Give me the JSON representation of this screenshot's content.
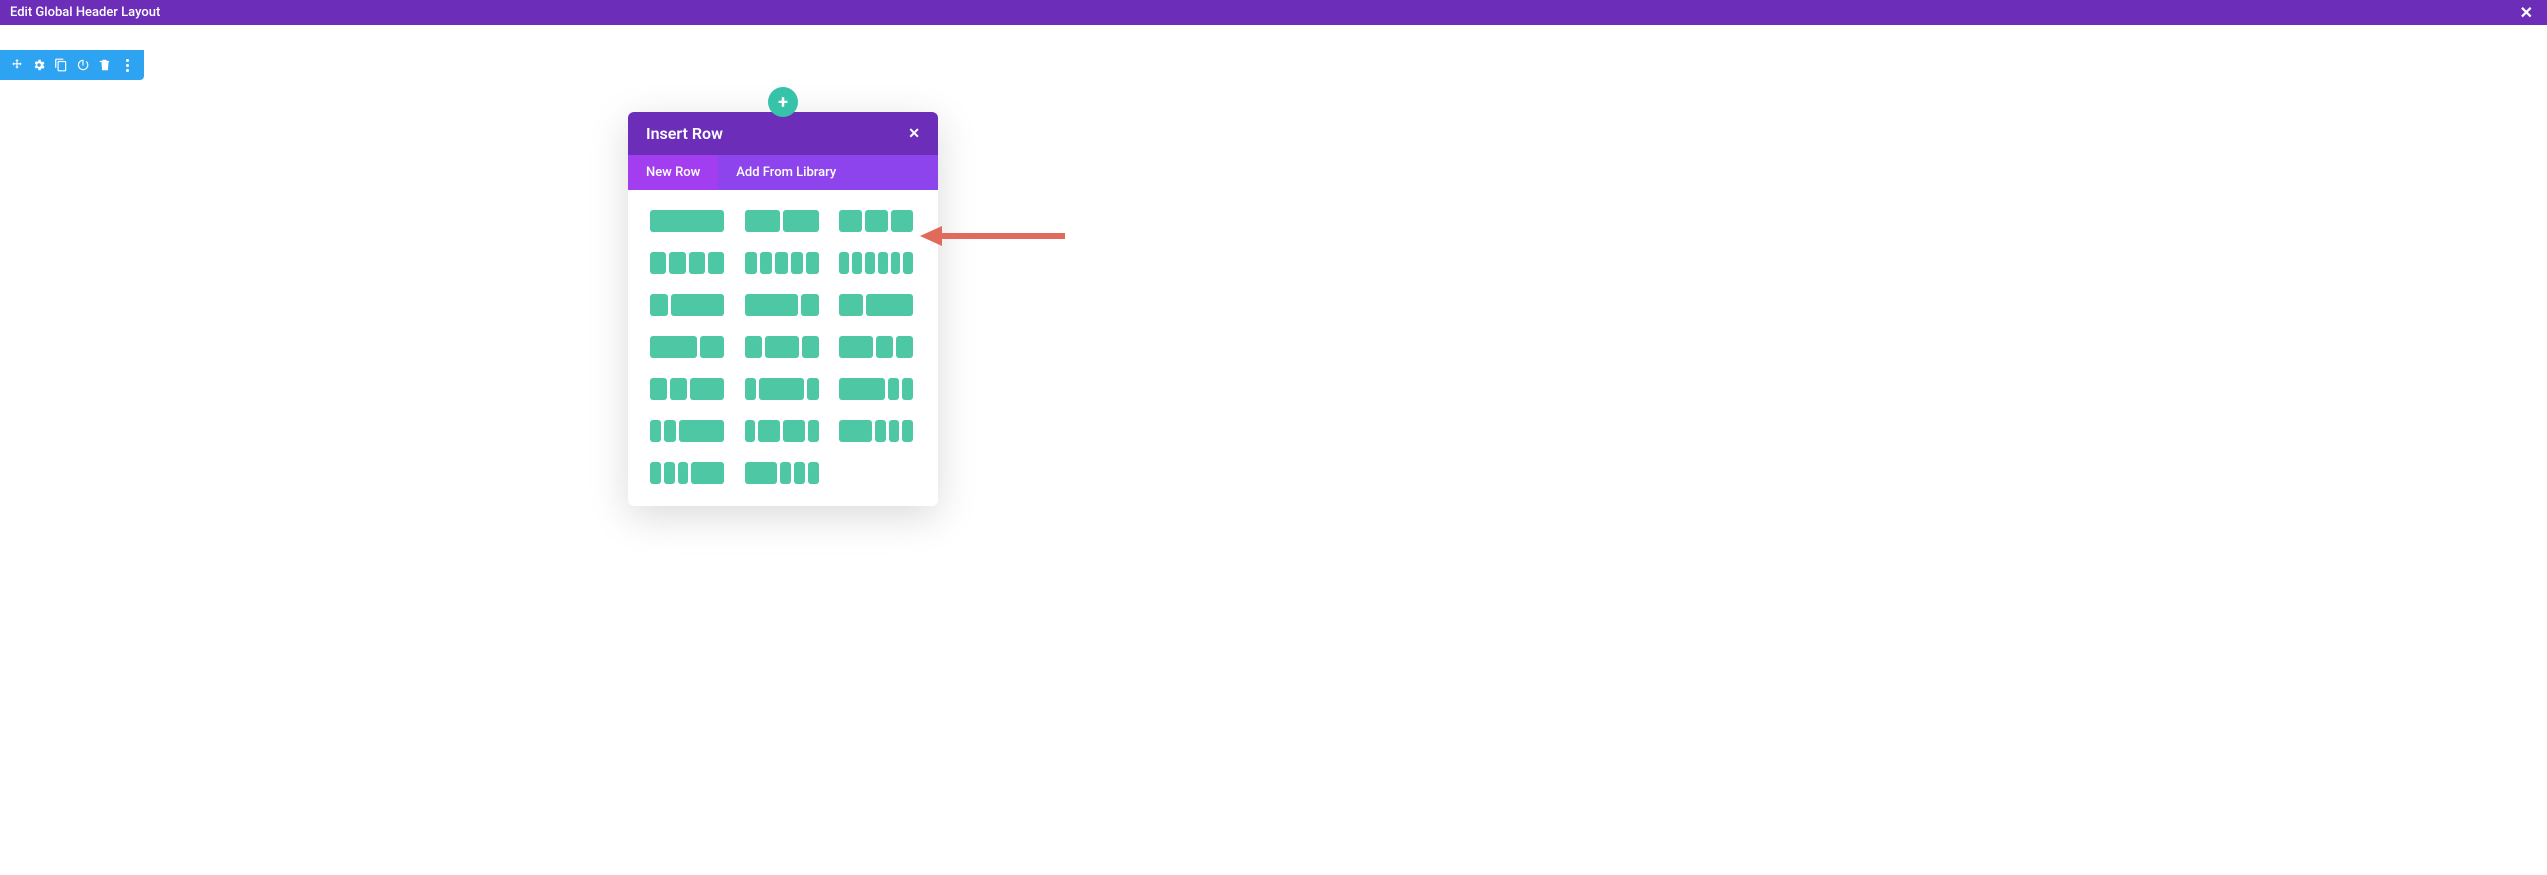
{
  "topbar": {
    "title": "Edit Global Header Layout"
  },
  "toolbar": {
    "icons": [
      "move",
      "settings",
      "duplicate",
      "power",
      "delete",
      "more"
    ]
  },
  "modal": {
    "title": "Insert Row",
    "tabs": {
      "new_row": "New Row",
      "add_from_library": "Add From Library"
    },
    "active_tab": "new_row",
    "layouts": [
      {
        "id": "1col",
        "cols": [
          1
        ]
      },
      {
        "id": "2col",
        "cols": [
          1,
          1
        ]
      },
      {
        "id": "3col",
        "cols": [
          1,
          1,
          1
        ]
      },
      {
        "id": "4col",
        "cols": [
          1,
          1,
          1,
          1
        ]
      },
      {
        "id": "5col",
        "cols": [
          1,
          1,
          1,
          1,
          1
        ]
      },
      {
        "id": "6col",
        "cols": [
          1,
          1,
          1,
          1,
          1,
          1
        ]
      },
      {
        "id": "25-75",
        "cols": [
          1,
          3
        ]
      },
      {
        "id": "75-25",
        "cols": [
          3,
          1
        ]
      },
      {
        "id": "33-67",
        "cols": [
          1,
          2
        ]
      },
      {
        "id": "67-33",
        "cols": [
          2,
          1
        ]
      },
      {
        "id": "25-50-25",
        "cols": [
          1,
          2,
          1
        ]
      },
      {
        "id": "50-25-25",
        "cols": [
          2,
          1,
          1
        ]
      },
      {
        "id": "25-25-50",
        "cols": [
          1,
          1,
          2
        ]
      },
      {
        "id": "16-67-16",
        "cols": [
          1,
          4,
          1
        ]
      },
      {
        "id": "67-16-16",
        "cols": [
          4,
          1,
          1
        ]
      },
      {
        "id": "16-16-67",
        "cols": [
          1,
          1,
          4
        ]
      },
      {
        "id": "14-36-36-14",
        "cols": [
          1,
          2,
          2,
          1
        ]
      },
      {
        "id": "50-16-16-16",
        "cols": [
          3,
          1,
          1,
          1
        ]
      },
      {
        "id": "16-16-16-50",
        "cols": [
          1,
          1,
          1,
          3
        ]
      },
      {
        "id": "50-17-17-17b",
        "cols": [
          3,
          1,
          1,
          1
        ]
      }
    ]
  },
  "colors": {
    "purple": "#6c2eb9",
    "purple_light": "#8e44ec",
    "purple_active": "#a23ef0",
    "teal": "#37c2aa",
    "green_block": "#4ec7a5",
    "blue_toolbar": "#2ea3f2",
    "arrow_red": "#e06a5b"
  }
}
